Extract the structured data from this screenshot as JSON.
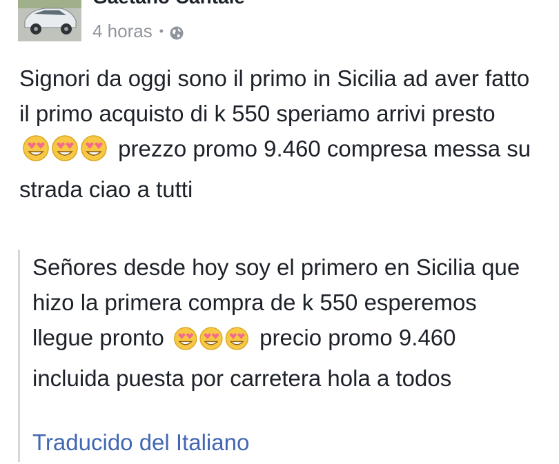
{
  "post": {
    "author_name": "Gaetano Cantale",
    "timestamp": "4 horas",
    "separator": "•",
    "privacy_icon": "globe-icon",
    "original_text": {
      "part1": "Signori da oggi sono il primo in Sicilia ad aver fatto il primo acquisto di k 550 speriamo arrivi presto",
      "emoji": "smiling-face-heart-eyes x3",
      "part2": "prezzo promo 9.460 compresa messa su strada ciao a tutti"
    },
    "translation": {
      "part1": "Señores desde hoy soy el primero en Sicilia que hizo la primera compra de k 550 esperemos llegue pronto",
      "emoji": "smiling-face-heart-eyes x3",
      "part2": "precio promo 9.460 incluida puesta por carretera hola a todos",
      "translated_from_label": "Traducido del Italiano"
    }
  },
  "colors": {
    "text": "#1d2129",
    "meta": "#90949c",
    "link": "#4267b2",
    "quote_border": "#d3d6db",
    "emoji_face": "#f7c843",
    "emoji_heart": "#f26b8a"
  }
}
